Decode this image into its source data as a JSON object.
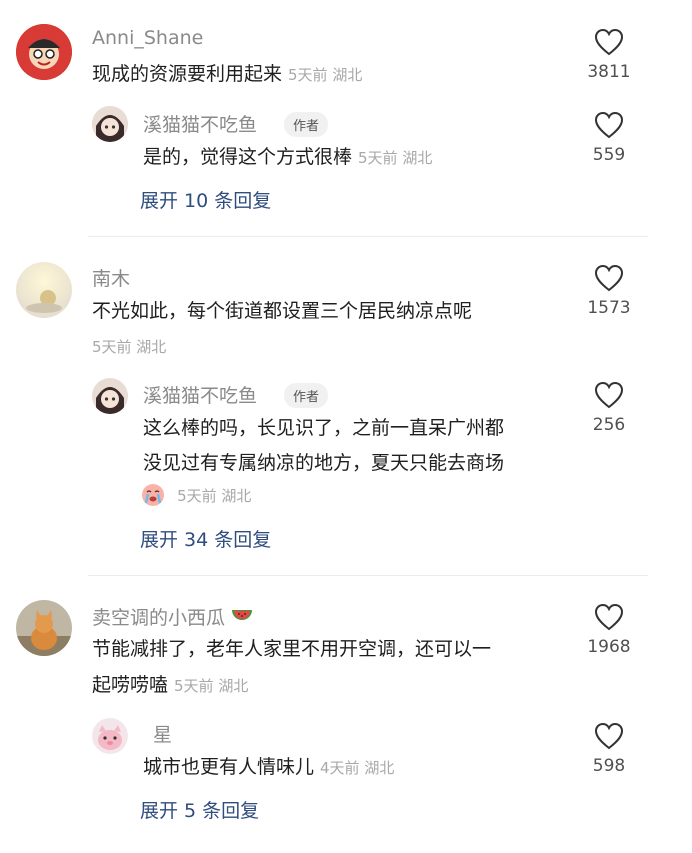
{
  "comments": [
    {
      "user": "Anni_Shane",
      "text": "现成的资源要利用起来",
      "meta": "5天前 湖北",
      "likes": "3811",
      "replies": [
        {
          "user": "溪猫猫不吃鱼",
          "badge": "作者",
          "text": "是的，觉得这个方式很棒",
          "meta": "5天前 湖北",
          "likes": "559"
        }
      ],
      "expand": "展开 10 条回复"
    },
    {
      "user": "南木",
      "text": "不光如此，每个街道都设置三个居民纳凉点呢",
      "meta": "5天前 湖北",
      "likes": "1573",
      "replies": [
        {
          "user": "溪猫猫不吃鱼",
          "badge": "作者",
          "text_line1": "这么棒的吗，长见识了，之前一直呆广州都",
          "text_line2": "没见过有专属纳凉的地方，夏天只能去商场",
          "meta": "5天前 湖北",
          "likes": "256"
        }
      ],
      "expand": "展开 34 条回复"
    },
    {
      "user": "卖空调的小西瓜",
      "text_line1": "节能减排了，老年人家里不用开空调，还可以一",
      "text_line2": "起唠唠嗑",
      "meta": "5天前 湖北",
      "likes": "1968",
      "replies": [
        {
          "user": "星",
          "text": "城市也更有人情味儿",
          "meta": "4天前 湖北",
          "likes": "598"
        }
      ],
      "expand": "展开 5 条回复"
    }
  ],
  "icons": {
    "like": "heart-outline-icon",
    "reply_emoji": "crying-face-emoji-icon",
    "name_emoji": "watermelon-icon"
  },
  "colors": {
    "expand_link": "#2f4d7e",
    "meta": "#a8a8a8",
    "username": "#8a8a8a"
  }
}
